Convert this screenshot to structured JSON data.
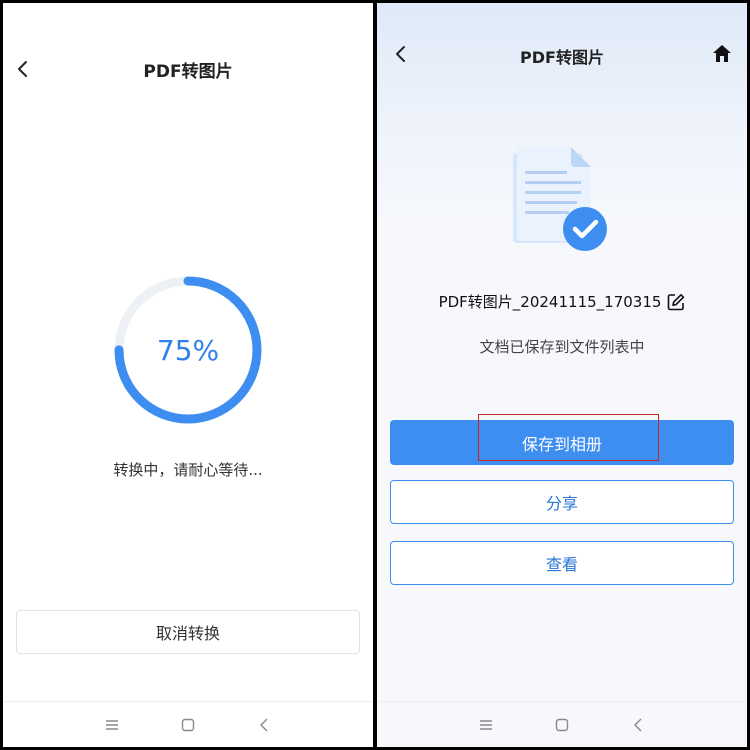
{
  "left": {
    "title": "PDF转图片",
    "progress": {
      "percent": 75,
      "label": "75%",
      "color": "#3d8ef0",
      "track_color": "#edf0f4"
    },
    "status_text": "转换中，请耐心等待...",
    "cancel_label": "取消转换"
  },
  "right": {
    "title": "PDF转图片",
    "filename": "PDF转图片_20241115_170315",
    "saved_message": "文档已保存到文件列表中",
    "buttons": {
      "save_to_album": "保存到相册",
      "share": "分享",
      "view": "查看"
    },
    "accent_color": "#3d8ef0",
    "highlight_color": "#c7271e"
  },
  "navbar": {
    "icons": [
      "menu-icon",
      "home-square-icon",
      "back-triangle-icon"
    ]
  }
}
